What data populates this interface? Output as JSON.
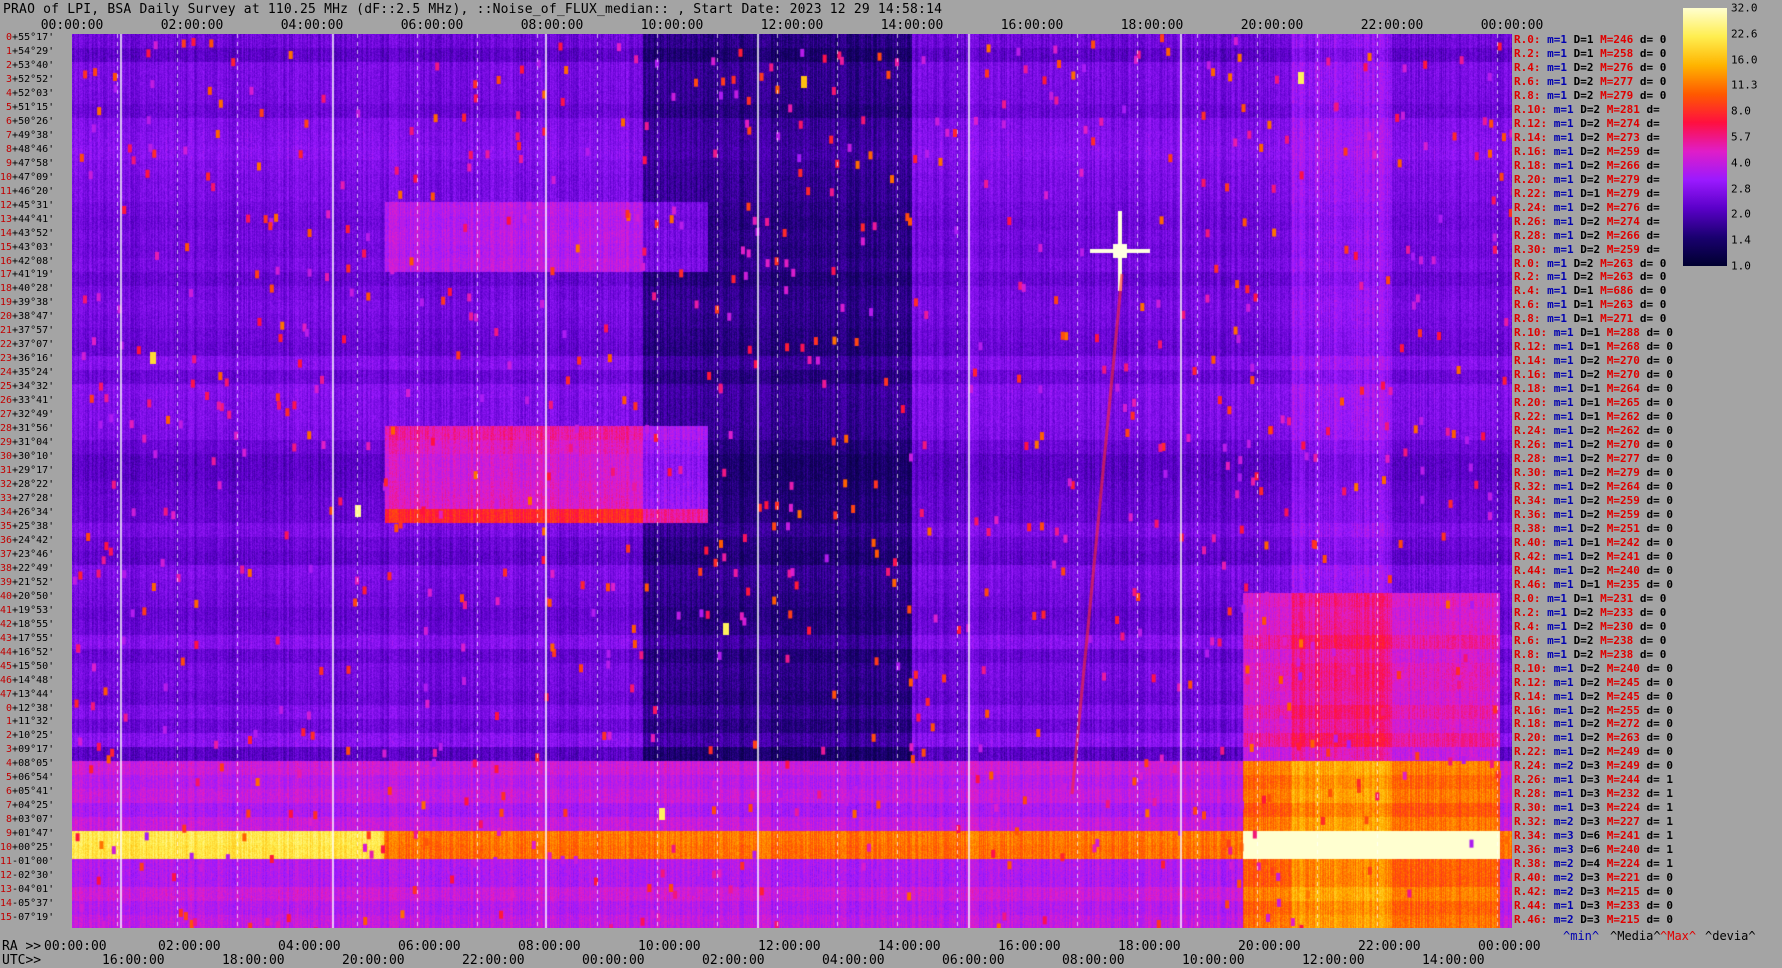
{
  "title": "PRAO of LPI, BSA Daily Survey at 110.25 MHz (dF::2.5 MHz), ::Noise_of_FLUX_median:: , Start Date: 2023 12 29 14:58:14",
  "top_time_ticks": [
    "00:00:00",
    "02:00:00",
    "04:00:00",
    "06:00:00",
    "08:00:00",
    "10:00:00",
    "12:00:00",
    "14:00:00",
    "16:00:00",
    "18:00:00",
    "20:00:00",
    "22:00:00",
    "00:00:00"
  ],
  "ra_label": "RA >>",
  "ra_ticks": [
    "00:00:00",
    "02:00:00",
    "04:00:00",
    "06:00:00",
    "08:00:00",
    "10:00:00",
    "12:00:00",
    "14:00:00",
    "16:00:00",
    "18:00:00",
    "20:00:00",
    "22:00:00",
    "00:00:00"
  ],
  "utc_label": "UTC>>",
  "utc_ticks": [
    "16:00:00",
    "18:00:00",
    "20:00:00",
    "22:00:00",
    "00:00:00",
    "02:00:00",
    "04:00:00",
    "06:00:00",
    "08:00:00",
    "10:00:00",
    "12:00:00",
    "14:00:00"
  ],
  "declinations": [
    "+55°17'",
    "+54°29'",
    "+53°40'",
    "+52°52'",
    "+52°03'",
    "+51°15'",
    "+50°26'",
    "+49°38'",
    "+48°46'",
    "+47°58'",
    "+47°09'",
    "+46°20'",
    "+45°31'",
    "+44°41'",
    "+43°52'",
    "+43°03'",
    "+42°08'",
    "+41°19'",
    "+40°28'",
    "+39°38'",
    "+38°47'",
    "+37°57'",
    "+37°07'",
    "+36°16'",
    "+35°24'",
    "+34°32'",
    "+33°41'",
    "+32°49'",
    "+31°56'",
    "+31°04'",
    "+30°10'",
    "+29°17'",
    "+28°22'",
    "+27°28'",
    "+26°34'",
    "+25°38'",
    "+24°42'",
    "+23°46'",
    "+22°49'",
    "+21°52'",
    "+20°50'",
    "+19°53'",
    "+18°55'",
    "+17°55'",
    "+16°52'",
    "+15°50'",
    "+14°48'",
    "+13°44'",
    "+12°38'",
    "+11°32'",
    "+10°25'",
    "+09°17'",
    "+08°05'",
    "+06°54'",
    "+05°41'",
    "+04°25'",
    "+03°07'",
    "+01°47'",
    "+00°25'",
    "-01°00'",
    "-02°30'",
    "-04°01'",
    "-05°37'",
    "-07°19'"
  ],
  "row_stats": [
    {
      "r": "R.0:",
      "m": "m=1",
      "d": "D=1",
      "M": "M=246",
      "dv": "d= 0"
    },
    {
      "r": "R.2:",
      "m": "m=1",
      "d": "D=1",
      "M": "M=258",
      "dv": "d= 0"
    },
    {
      "r": "R.4:",
      "m": "m=1",
      "d": "D=2",
      "M": "M=276",
      "dv": "d= 0"
    },
    {
      "r": "R.6:",
      "m": "m=1",
      "d": "D=2",
      "M": "M=277",
      "dv": "d= 0"
    },
    {
      "r": "R.8:",
      "m": "m=1",
      "d": "D=2",
      "M": "M=279",
      "dv": "d= 0"
    },
    {
      "r": "R.10:",
      "m": "m=1",
      "d": "D=2",
      "M": "M=281",
      "dv": "d="
    },
    {
      "r": "R.12:",
      "m": "m=1",
      "d": "D=2",
      "M": "M=274",
      "dv": "d="
    },
    {
      "r": "R.14:",
      "m": "m=1",
      "d": "D=2",
      "M": "M=273",
      "dv": "d="
    },
    {
      "r": "R.16:",
      "m": "m=1",
      "d": "D=2",
      "M": "M=259",
      "dv": "d="
    },
    {
      "r": "R.18:",
      "m": "m=1",
      "d": "D=2",
      "M": "M=266",
      "dv": "d="
    },
    {
      "r": "R.20:",
      "m": "m=1",
      "d": "D=2",
      "M": "M=279",
      "dv": "d="
    },
    {
      "r": "R.22:",
      "m": "m=1",
      "d": "D=1",
      "M": "M=279",
      "dv": "d="
    },
    {
      "r": "R.24:",
      "m": "m=1",
      "d": "D=2",
      "M": "M=276",
      "dv": "d="
    },
    {
      "r": "R.26:",
      "m": "m=1",
      "d": "D=2",
      "M": "M=274",
      "dv": "d="
    },
    {
      "r": "R.28:",
      "m": "m=1",
      "d": "D=2",
      "M": "M=266",
      "dv": "d="
    },
    {
      "r": "R.30:",
      "m": "m=1",
      "d": "D=2",
      "M": "M=259",
      "dv": "d="
    },
    {
      "r": "R.0:",
      "m": "m=1",
      "d": "D=2",
      "M": "M=263",
      "dv": "d= 0"
    },
    {
      "r": "R.2:",
      "m": "m=1",
      "d": "D=2",
      "M": "M=263",
      "dv": "d= 0"
    },
    {
      "r": "R.4:",
      "m": "m=1",
      "d": "D=1",
      "M": "M=686",
      "dv": "d= 0"
    },
    {
      "r": "R.6:",
      "m": "m=1",
      "d": "D=1",
      "M": "M=263",
      "dv": "d= 0"
    },
    {
      "r": "R.8:",
      "m": "m=1",
      "d": "D=1",
      "M": "M=271",
      "dv": "d= 0"
    },
    {
      "r": "R.10:",
      "m": "m=1",
      "d": "D=1",
      "M": "M=288",
      "dv": "d= 0"
    },
    {
      "r": "R.12:",
      "m": "m=1",
      "d": "D=1",
      "M": "M=268",
      "dv": "d= 0"
    },
    {
      "r": "R.14:",
      "m": "m=1",
      "d": "D=2",
      "M": "M=270",
      "dv": "d= 0"
    },
    {
      "r": "R.16:",
      "m": "m=1",
      "d": "D=2",
      "M": "M=270",
      "dv": "d= 0"
    },
    {
      "r": "R.18:",
      "m": "m=1",
      "d": "D=1",
      "M": "M=264",
      "dv": "d= 0"
    },
    {
      "r": "R.20:",
      "m": "m=1",
      "d": "D=1",
      "M": "M=265",
      "dv": "d= 0"
    },
    {
      "r": "R.22:",
      "m": "m=1",
      "d": "D=1",
      "M": "M=262",
      "dv": "d= 0"
    },
    {
      "r": "R.24:",
      "m": "m=1",
      "d": "D=2",
      "M": "M=262",
      "dv": "d= 0"
    },
    {
      "r": "R.26:",
      "m": "m=1",
      "d": "D=2",
      "M": "M=270",
      "dv": "d= 0"
    },
    {
      "r": "R.28:",
      "m": "m=1",
      "d": "D=2",
      "M": "M=277",
      "dv": "d= 0"
    },
    {
      "r": "R.30:",
      "m": "m=1",
      "d": "D=2",
      "M": "M=279",
      "dv": "d= 0"
    },
    {
      "r": "R.32:",
      "m": "m=1",
      "d": "D=2",
      "M": "M=264",
      "dv": "d= 0"
    },
    {
      "r": "R.34:",
      "m": "m=1",
      "d": "D=2",
      "M": "M=259",
      "dv": "d= 0"
    },
    {
      "r": "R.36:",
      "m": "m=1",
      "d": "D=2",
      "M": "M=259",
      "dv": "d= 0"
    },
    {
      "r": "R.38:",
      "m": "m=1",
      "d": "D=2",
      "M": "M=251",
      "dv": "d= 0"
    },
    {
      "r": "R.40:",
      "m": "m=1",
      "d": "D=1",
      "M": "M=242",
      "dv": "d= 0"
    },
    {
      "r": "R.42:",
      "m": "m=1",
      "d": "D=2",
      "M": "M=241",
      "dv": "d= 0"
    },
    {
      "r": "R.44:",
      "m": "m=1",
      "d": "D=2",
      "M": "M=240",
      "dv": "d= 0"
    },
    {
      "r": "R.46:",
      "m": "m=1",
      "d": "D=1",
      "M": "M=235",
      "dv": "d= 0"
    },
    {
      "r": "R.0:",
      "m": "m=1",
      "d": "D=1",
      "M": "M=231",
      "dv": "d= 0"
    },
    {
      "r": "R.2:",
      "m": "m=1",
      "d": "D=2",
      "M": "M=233",
      "dv": "d= 0"
    },
    {
      "r": "R.4:",
      "m": "m=1",
      "d": "D=2",
      "M": "M=230",
      "dv": "d= 0"
    },
    {
      "r": "R.6:",
      "m": "m=1",
      "d": "D=2",
      "M": "M=238",
      "dv": "d= 0"
    },
    {
      "r": "R.8:",
      "m": "m=1",
      "d": "D=2",
      "M": "M=238",
      "dv": "d= 0"
    },
    {
      "r": "R.10:",
      "m": "m=1",
      "d": "D=2",
      "M": "M=240",
      "dv": "d= 0"
    },
    {
      "r": "R.12:",
      "m": "m=1",
      "d": "D=2",
      "M": "M=245",
      "dv": "d= 0"
    },
    {
      "r": "R.14:",
      "m": "m=1",
      "d": "D=2",
      "M": "M=245",
      "dv": "d= 0"
    },
    {
      "r": "R.16:",
      "m": "m=1",
      "d": "D=2",
      "M": "M=255",
      "dv": "d= 0"
    },
    {
      "r": "R.18:",
      "m": "m=1",
      "d": "D=2",
      "M": "M=272",
      "dv": "d= 0"
    },
    {
      "r": "R.20:",
      "m": "m=1",
      "d": "D=2",
      "M": "M=263",
      "dv": "d= 0"
    },
    {
      "r": "R.22:",
      "m": "m=1",
      "d": "D=2",
      "M": "M=249",
      "dv": "d= 0"
    },
    {
      "r": "R.24:",
      "m": "m=2",
      "d": "D=3",
      "M": "M=249",
      "dv": "d= 0"
    },
    {
      "r": "R.26:",
      "m": "m=1",
      "d": "D=3",
      "M": "M=244",
      "dv": "d= 1"
    },
    {
      "r": "R.28:",
      "m": "m=1",
      "d": "D=3",
      "M": "M=232",
      "dv": "d= 1"
    },
    {
      "r": "R.30:",
      "m": "m=1",
      "d": "D=3",
      "M": "M=224",
      "dv": "d= 1"
    },
    {
      "r": "R.32:",
      "m": "m=2",
      "d": "D=3",
      "M": "M=227",
      "dv": "d= 1"
    },
    {
      "r": "R.34:",
      "m": "m=3",
      "d": "D=6",
      "M": "M=241",
      "dv": "d= 1"
    },
    {
      "r": "R.36:",
      "m": "m=3",
      "d": "D=6",
      "M": "M=240",
      "dv": "d= 1"
    },
    {
      "r": "R.38:",
      "m": "m=2",
      "d": "D=4",
      "M": "M=224",
      "dv": "d= 1"
    },
    {
      "r": "R.40:",
      "m": "m=2",
      "d": "D=3",
      "M": "M=221",
      "dv": "d= 0"
    },
    {
      "r": "R.42:",
      "m": "m=2",
      "d": "D=3",
      "M": "M=215",
      "dv": "d= 0"
    },
    {
      "r": "R.44:",
      "m": "m=1",
      "d": "D=3",
      "M": "M=233",
      "dv": "d= 0"
    },
    {
      "r": "R.46:",
      "m": "m=2",
      "d": "D=3",
      "M": "M=215",
      "dv": "d= 0"
    }
  ],
  "colorbar": {
    "ticks": [
      "32.0",
      "22.6",
      "16.0",
      "11.3",
      "8.0",
      "5.7",
      "4.0",
      "2.8",
      "2.0",
      "1.4",
      "1.0"
    ],
    "colors": [
      "#000030",
      "#1a0070",
      "#5a00c8",
      "#9b1aff",
      "#e01ec8",
      "#ff1040",
      "#ff5a00",
      "#ffb400",
      "#ffee50",
      "#ffffd0"
    ]
  },
  "legend": {
    "min": "^min^",
    "media": "^Media^",
    "max": "^Max^",
    "devia": "^devia^"
  },
  "chart_data": {
    "type": "heatmap",
    "title": "PRAO of LPI, BSA Daily Survey at 110.25 MHz (dF::2.5 MHz), ::Noise_of_FLUX_median:: , Start Date: 2023 12 29 14:58:14",
    "x_axis": "RA 00:00:00 → 24:00:00",
    "y_axis": "Declination +55°17' → -07°19'",
    "color_scale": "log",
    "value_range": [
      1.0,
      32.0
    ],
    "features": [
      {
        "ra": "20:00",
        "dec": "+41°19'",
        "value": 32.0
      },
      {
        "ra": "00:00-24:00",
        "dec": "+01°47'..+00°25'",
        "value": 8.0
      },
      {
        "ra": "20:00-24:00",
        "dec": "+08°05'..-07°19'",
        "value": 16.0
      },
      {
        "ra": "05:00-11:00",
        "dec": "+31°56'..+25°38'",
        "value": 4.0
      }
    ]
  }
}
